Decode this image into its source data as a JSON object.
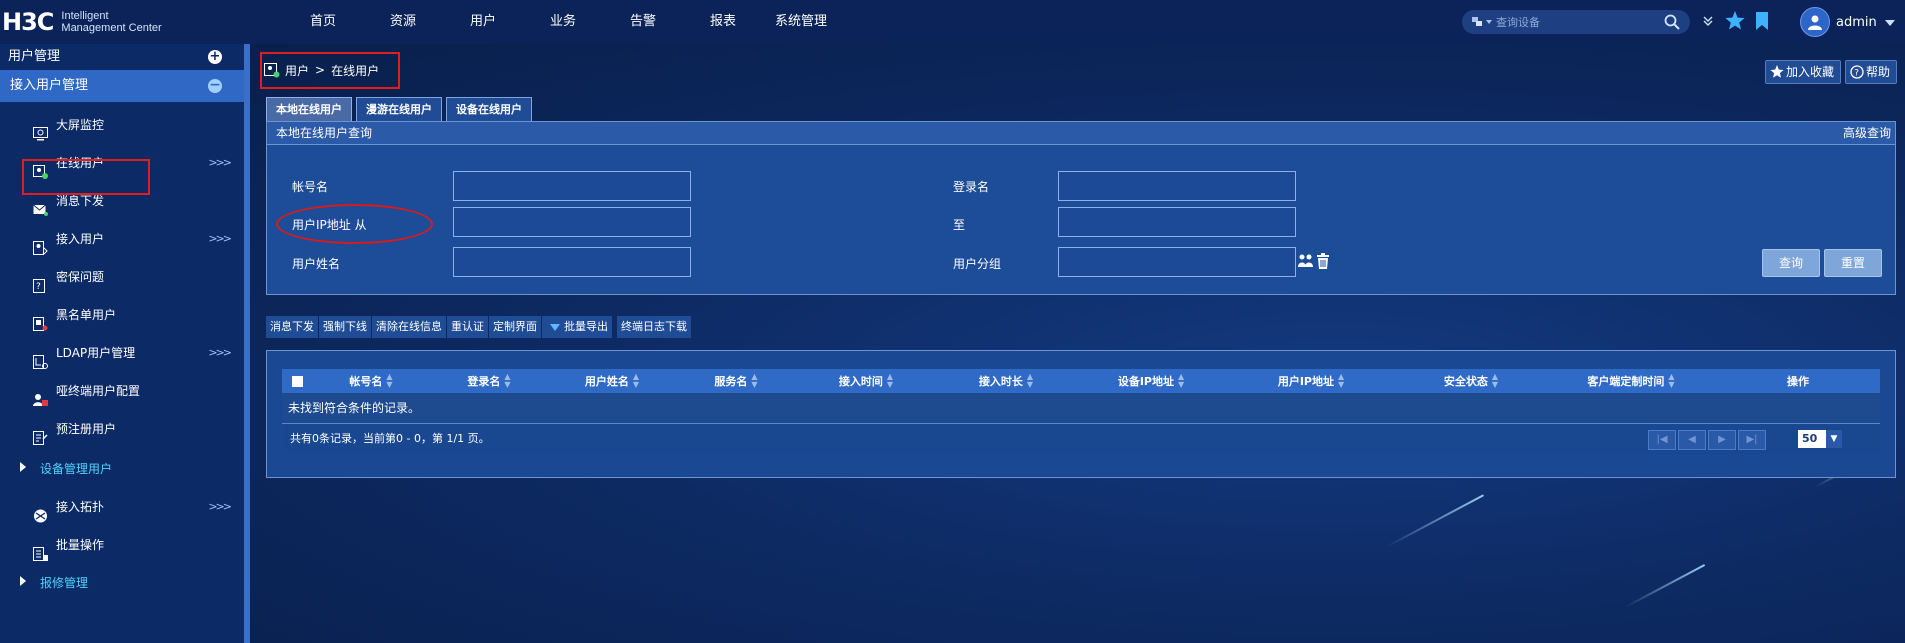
{
  "logo": {
    "brand": "H3C",
    "line1": "Intelligent",
    "line2": "Management Center"
  },
  "topnav": [
    "首页",
    "资源",
    "用户",
    "业务",
    "告警",
    "报表",
    "系统管理"
  ],
  "search": {
    "placeholder": "查询设备"
  },
  "user": {
    "name": "admin"
  },
  "sidebar": {
    "header": "用户管理",
    "active_group": "接入用户管理",
    "items": [
      {
        "label": "大屏监控",
        "more": false,
        "icon": "monitor-icon"
      },
      {
        "label": "在线用户",
        "more": true,
        "icon": "online-user-icon"
      },
      {
        "label": "消息下发",
        "more": false,
        "icon": "message-icon"
      },
      {
        "label": "接入用户",
        "more": true,
        "icon": "access-user-icon"
      },
      {
        "label": "密保问题",
        "more": false,
        "icon": "question-icon"
      },
      {
        "label": "黑名单用户",
        "more": false,
        "icon": "blacklist-icon"
      },
      {
        "label": "LDAP用户管理",
        "more": true,
        "icon": "ldap-icon"
      },
      {
        "label": "哑终端用户配置",
        "more": false,
        "icon": "terminal-icon"
      },
      {
        "label": "预注册用户",
        "more": false,
        "icon": "preregister-icon"
      }
    ],
    "section1": "设备管理用户",
    "items2": [
      {
        "label": "接入拓扑",
        "more": true,
        "icon": "topology-icon"
      },
      {
        "label": "批量操作",
        "more": false,
        "icon": "batch-icon"
      }
    ],
    "section2": "报修管理",
    "more_glyph": ">>>"
  },
  "breadcrumb": {
    "root": "用户",
    "sep": ">",
    "current": "在线用户"
  },
  "header_buttons": {
    "favorite": "加入收藏",
    "help": "帮助"
  },
  "tabs": [
    "本地在线用户",
    "漫游在线用户",
    "设备在线用户"
  ],
  "query": {
    "title": "本地在线用户查询",
    "advanced": "高级查询",
    "account_label": "帐号名",
    "login_label": "登录名",
    "ip_from_label": "用户IP地址 从",
    "ip_to_label": "至",
    "username_label": "用户姓名",
    "group_label": "用户分组",
    "search_button": "查询",
    "reset_button": "重置"
  },
  "toolbar": [
    "消息下发",
    "强制下线",
    "清除在线信息",
    "重认证",
    "定制界面",
    "批量导出",
    "终端日志下载"
  ],
  "grid": {
    "columns": [
      "帐号名",
      "登录名",
      "用户姓名",
      "服务名",
      "接入时间",
      "接入时长",
      "设备IP地址",
      "用户IP地址",
      "安全状态",
      "客户端定制时间",
      "操作"
    ],
    "empty": "未找到符合条件的记录。",
    "footer": "共有0条记录，当前第0 - 0，第 1/1 页。",
    "page_size": "50"
  },
  "colors": {
    "accent": "#2f68c5",
    "highlight": "#e01e1e",
    "section": "#54d1ff"
  }
}
